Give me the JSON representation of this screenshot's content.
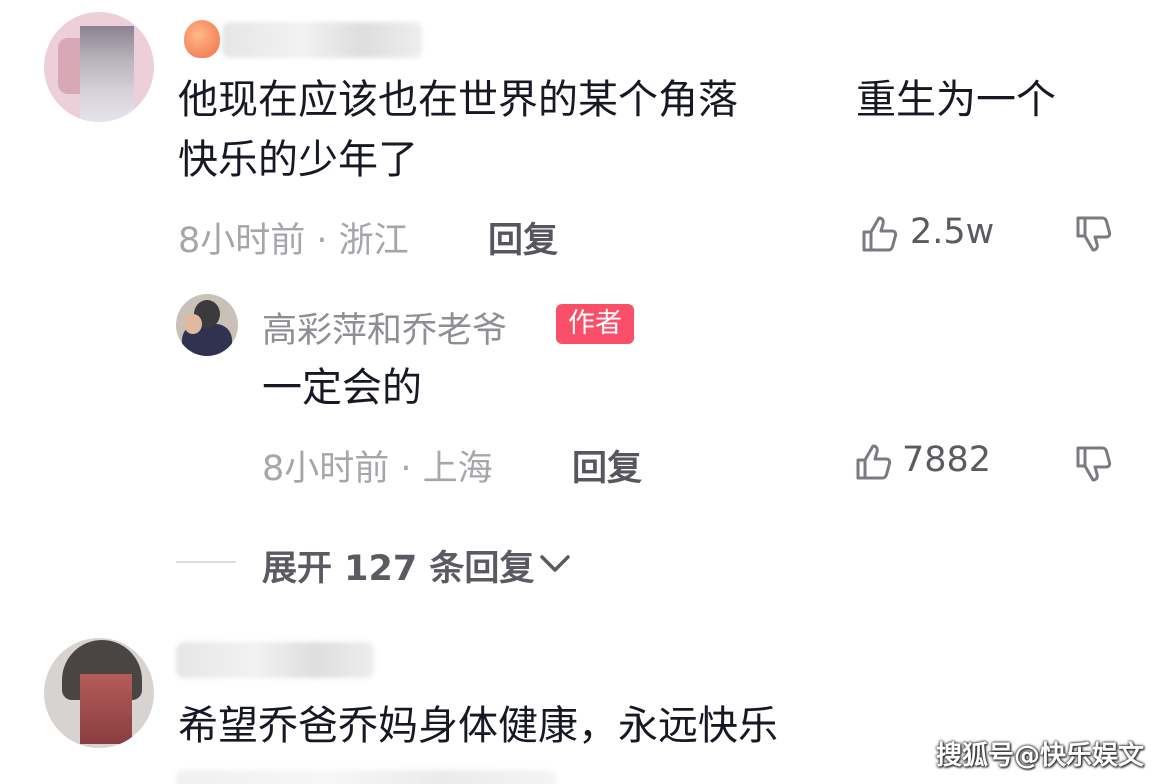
{
  "comments": [
    {
      "avatar": "avatar-pixelated",
      "text_line1": "他现在应该也在世界的某个角落",
      "text_line1b": "重生为一个",
      "text_line2": "快乐的少年了",
      "meta": "8小时前 · 浙江",
      "reply_label": "回复",
      "like_count": "2.5w",
      "reply": {
        "username": "高彩萍和乔老爷",
        "badge": "作者",
        "text": "一定会的",
        "meta": "8小时前 · 上海",
        "reply_label": "回复",
        "like_count": "7882"
      },
      "expand_label": "展开 127 条回复"
    },
    {
      "avatar": "avatar-pixelated",
      "text": "希望乔爸乔妈身体健康，永远快乐"
    }
  ],
  "icons": {
    "like": "thumbs-up-icon",
    "dislike": "thumbs-down-icon",
    "expand": "chevron-down-icon"
  },
  "watermark": "搜狐号@快乐娱文",
  "colors": {
    "text": "#161823",
    "meta": "#a5a6aa",
    "badge": "#f94f68"
  }
}
